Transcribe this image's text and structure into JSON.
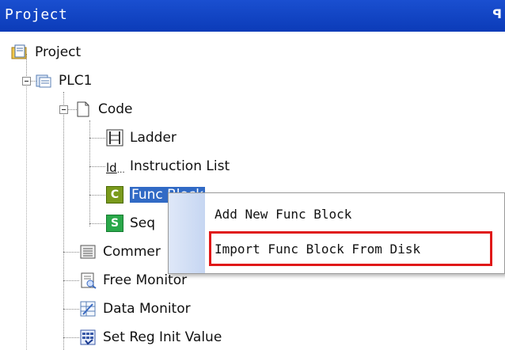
{
  "panel": {
    "title": "Project",
    "pin_glyph": "ꟼ"
  },
  "tree": {
    "root": "Project",
    "plc": "PLC1",
    "code": "Code",
    "ladder": "Ladder",
    "instruction_list": "Instruction List",
    "instruction_icon_text": "ld",
    "func_block": "Func Block",
    "func_icon_text": "C",
    "sequence": "Seq",
    "sequence_icon_text": "S",
    "comment": "Commer",
    "free_monitor": "Free Monitor",
    "data_monitor": "Data Monitor",
    "set_reg_init": "Set Reg Init Value"
  },
  "context_menu": {
    "items": [
      "Add New Func Block",
      "Import Func Block From Disk"
    ],
    "highlighted_index": 1
  },
  "colors": {
    "title_bar": "#0b3bb8",
    "highlight_border": "#e01818",
    "selection": "#316ac5"
  }
}
